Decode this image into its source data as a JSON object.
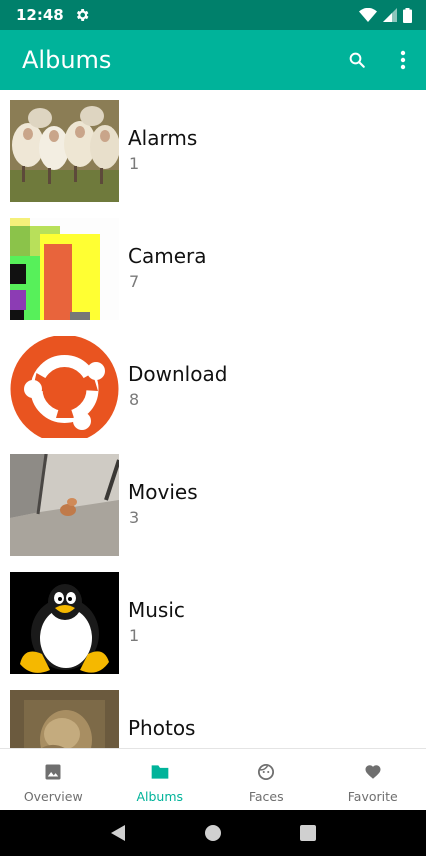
{
  "status_bar": {
    "time": "12:48",
    "icons": [
      "gear-icon",
      "wifi-icon",
      "signal-icon",
      "battery-icon"
    ]
  },
  "app_bar": {
    "title": "Albums",
    "icons": [
      "search-icon",
      "more-vert-icon"
    ],
    "color": "#00b39a"
  },
  "albums": [
    {
      "name": "Alarms",
      "count": "1",
      "thumb": "sheep-photo"
    },
    {
      "name": "Camera",
      "count": "7",
      "thumb": "colorful-blocks"
    },
    {
      "name": "Download",
      "count": "8",
      "thumb": "ubuntu-logo"
    },
    {
      "name": "Movies",
      "count": "3",
      "thumb": "floor-photo"
    },
    {
      "name": "Music",
      "count": "1",
      "thumb": "tux-penguin"
    },
    {
      "name": "Photos",
      "count": "",
      "thumb": "sepia-portrait"
    }
  ],
  "bottom_nav": {
    "items": [
      {
        "label": "Overview",
        "icon": "image-icon",
        "active": false
      },
      {
        "label": "Albums",
        "icon": "folder-icon",
        "active": true
      },
      {
        "label": "Faces",
        "icon": "face-icon",
        "active": false
      },
      {
        "label": "Favorite",
        "icon": "heart-icon",
        "active": false
      }
    ]
  },
  "system_nav": {
    "icons": [
      "back-icon",
      "home-icon",
      "recents-icon"
    ]
  }
}
